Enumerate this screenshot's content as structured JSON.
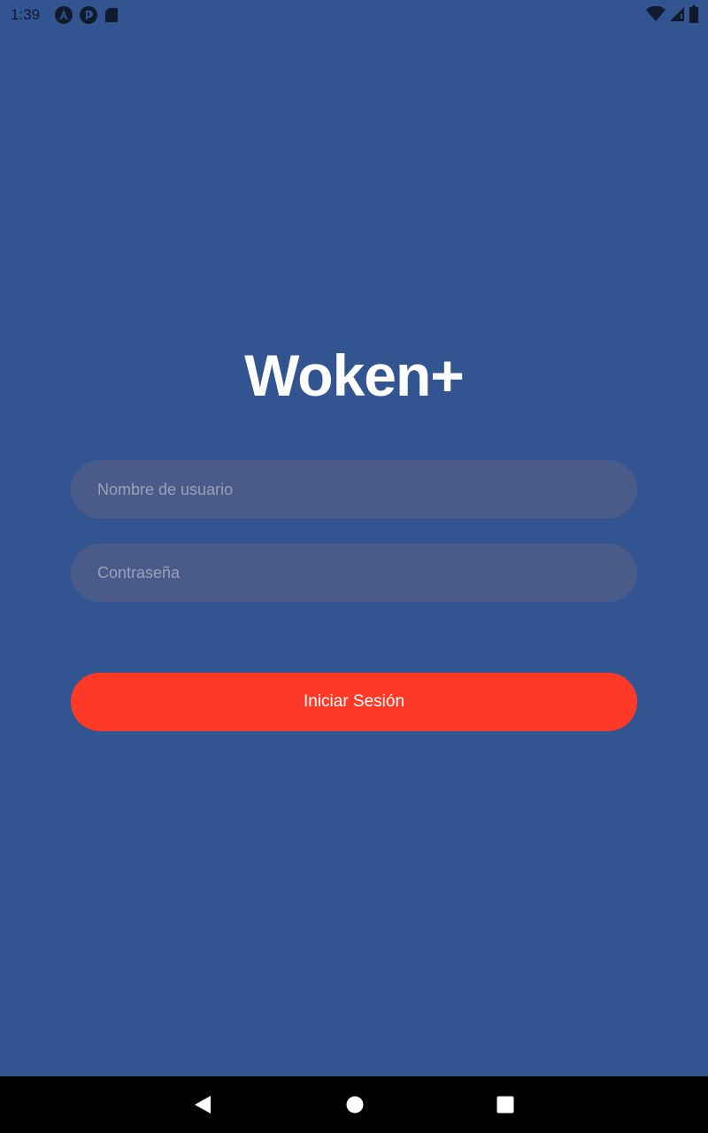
{
  "status_bar": {
    "time": "1:39",
    "left_icons": [
      "angular-notification-icon",
      "app-notification-icon",
      "sd-card-icon"
    ],
    "right_icons": [
      "wifi-icon",
      "cell-signal-icon",
      "battery-icon"
    ]
  },
  "app": {
    "title": "Woken+"
  },
  "login_form": {
    "username_placeholder": "Nombre de usuario",
    "username_value": "",
    "password_placeholder": "Contraseña",
    "password_value": "",
    "submit_label": "Iniciar Sesión"
  },
  "nav_bar": {
    "icons": [
      "back-icon",
      "home-icon",
      "recents-icon"
    ]
  },
  "colors": {
    "background": "#325591",
    "field_background": "#4a5b89",
    "button": "#fe3a27",
    "text": "#ffffff"
  }
}
